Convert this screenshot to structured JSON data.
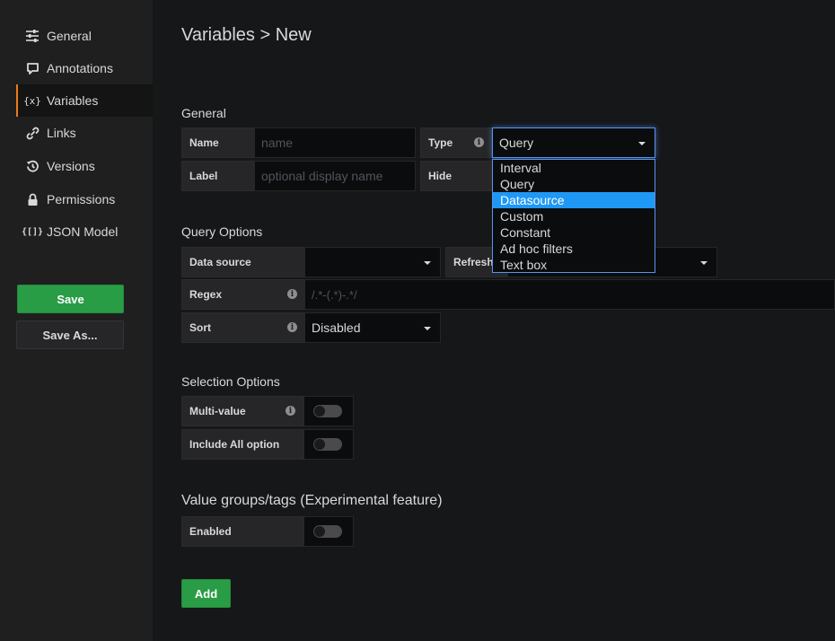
{
  "sidebar": {
    "items": [
      {
        "label": "General",
        "icon": "sliders-icon"
      },
      {
        "label": "Annotations",
        "icon": "comment-icon"
      },
      {
        "label": "Variables",
        "icon": "variable-icon",
        "icon_text": "{x}"
      },
      {
        "label": "Links",
        "icon": "link-icon"
      },
      {
        "label": "Versions",
        "icon": "history-icon"
      },
      {
        "label": "Permissions",
        "icon": "lock-icon"
      },
      {
        "label": "JSON Model",
        "icon": "json-icon",
        "icon_text": "{[]}"
      }
    ],
    "active_item": "Variables",
    "save_label": "Save",
    "save_as_label": "Save As..."
  },
  "page": {
    "title": "Variables > New"
  },
  "general": {
    "title": "General",
    "name_label": "Name",
    "name_placeholder": "name",
    "type_label": "Type",
    "type_value": "Query",
    "label_label": "Label",
    "label_placeholder": "optional display name",
    "hide_label": "Hide"
  },
  "type_dropdown": {
    "options": [
      "Interval",
      "Query",
      "Datasource",
      "Custom",
      "Constant",
      "Ad hoc filters",
      "Text box"
    ],
    "highlighted": "Datasource"
  },
  "query_options": {
    "title": "Query Options",
    "datasource_label": "Data source",
    "datasource_value": "",
    "refresh_label": "Refresh",
    "regex_label": "Regex",
    "regex_placeholder": "/.*-(.*)-.*/",
    "sort_label": "Sort",
    "sort_value": "Disabled"
  },
  "selection_options": {
    "title": "Selection Options",
    "multi_value_label": "Multi-value",
    "multi_value_enabled": false,
    "include_all_label": "Include All option",
    "include_all_enabled": false
  },
  "value_groups": {
    "title": "Value groups/tags (Experimental feature)",
    "enabled_label": "Enabled",
    "enabled": false
  },
  "add_label": "Add",
  "info_icon_char": "i",
  "colors": {
    "accent_orange": "#eb7b18",
    "primary_green": "#299c46",
    "focus_blue": "#5794f2",
    "selected_blue": "#1f98f5",
    "background": "#161719",
    "sidebar_bg": "#1f1f20"
  }
}
